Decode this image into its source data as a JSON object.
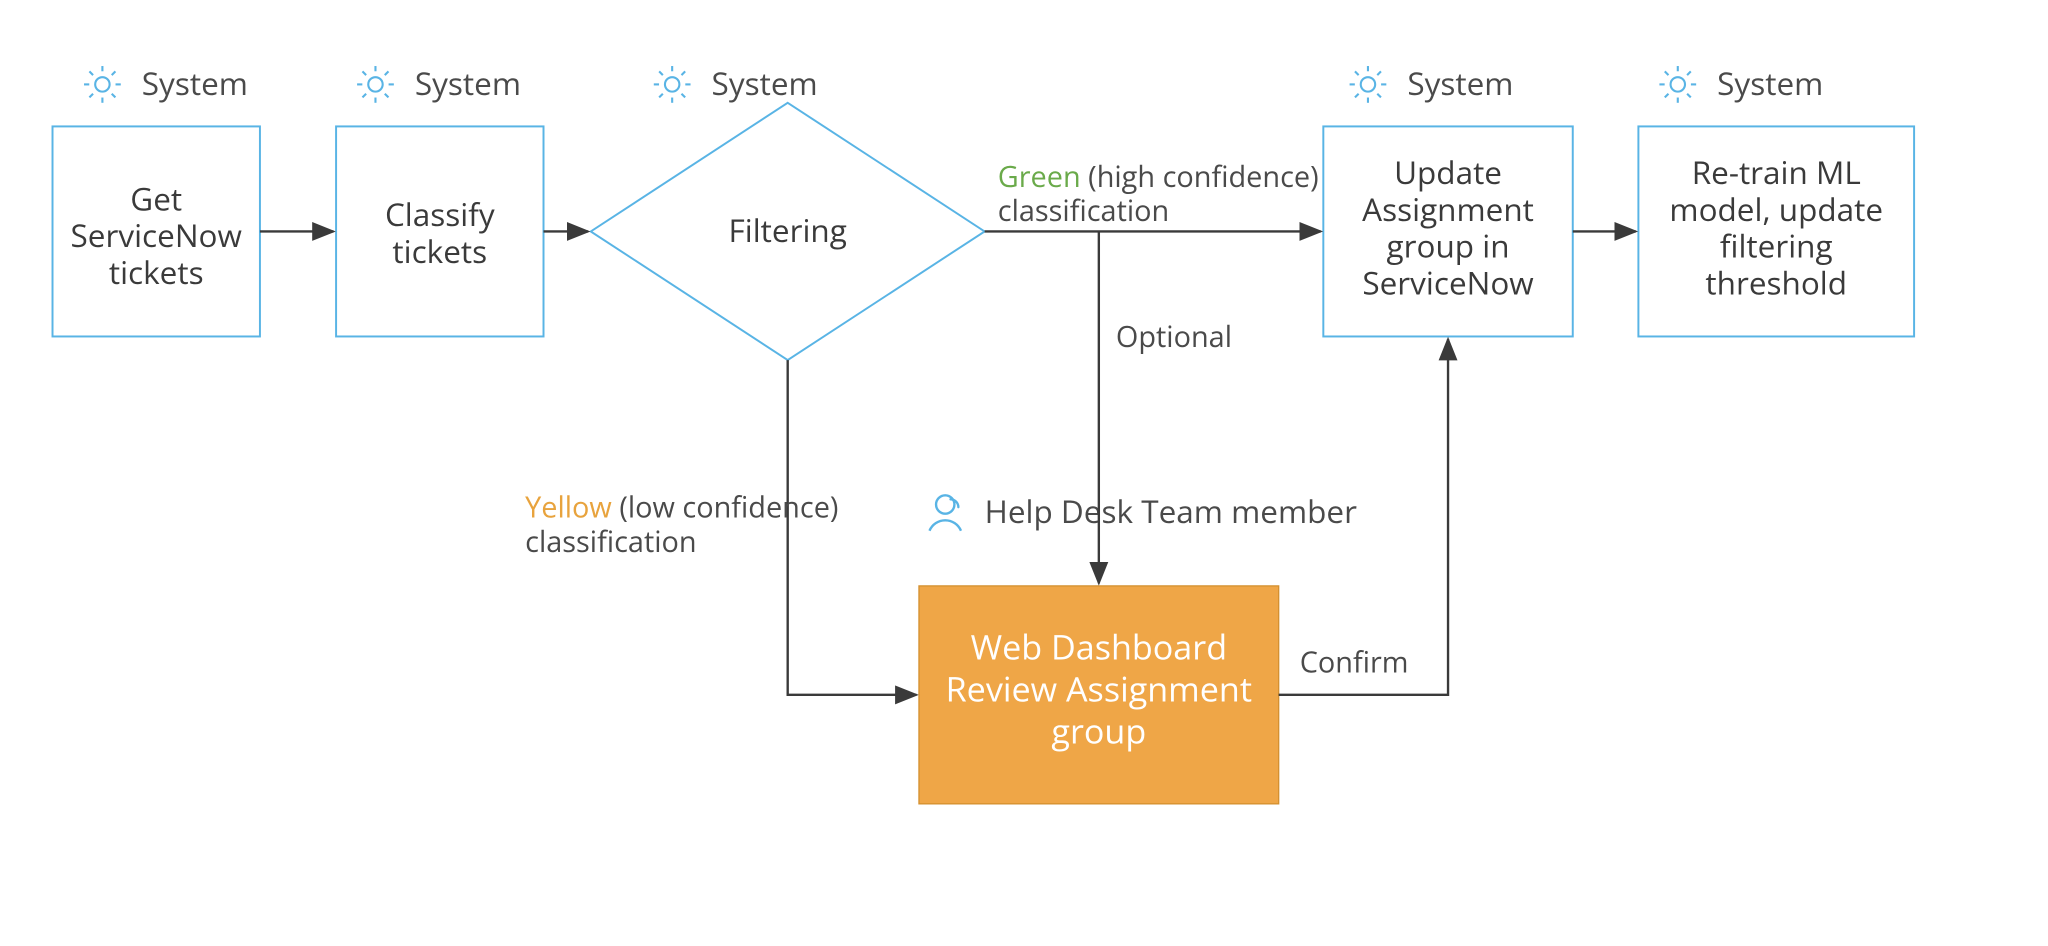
{
  "headers": {
    "system": "System",
    "helpdesk": "Help Desk Team member"
  },
  "nodes": {
    "get_tickets": {
      "line1": "Get",
      "line2": "ServiceNow",
      "line3": "tickets"
    },
    "classify": {
      "line1": "Classify",
      "line2": "tickets"
    },
    "filtering": {
      "line1": "Filtering"
    },
    "update": {
      "line1": "Update",
      "line2": "Assignment",
      "line3": "group in",
      "line4": "ServiceNow"
    },
    "retrain": {
      "line1": "Re-train ML",
      "line2": "model, update",
      "line3": "filtering",
      "line4": "threshold"
    },
    "dashboard": {
      "line1": "Web Dashboard",
      "line2": "Review Assignment",
      "line3": "group"
    }
  },
  "edges": {
    "green": {
      "word": "Green",
      "rest": " (high confidence)",
      "line2": "classification"
    },
    "yellow": {
      "word": "Yellow",
      "rest": " (low confidence)",
      "line2": "classification"
    },
    "optional": "Optional",
    "confirm": "Confirm"
  }
}
